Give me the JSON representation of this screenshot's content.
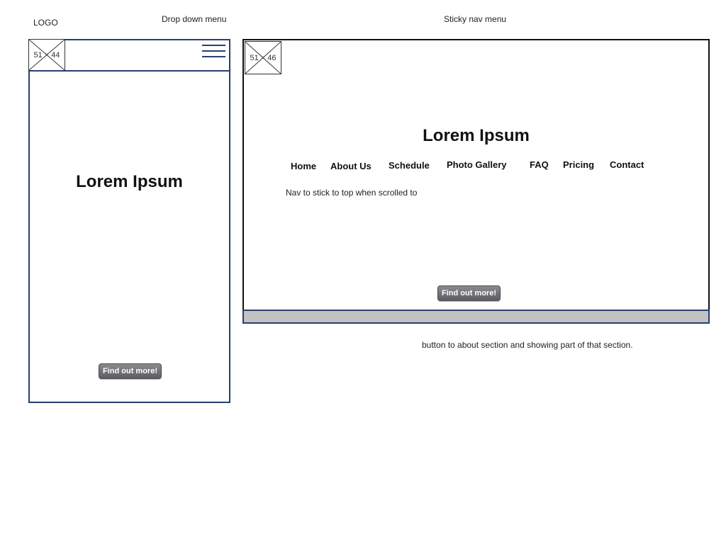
{
  "annotations": {
    "logo": "LOGO",
    "dropdown": "Drop down menu",
    "sticky": "Sticky nav menu",
    "button_note": "button to about section and showing part of that section."
  },
  "mobile": {
    "logo_placeholder": "51 × 44",
    "menu_icon": "hamburger-menu-icon",
    "title": "Lorem Ipsum",
    "button": "Find out more!"
  },
  "desktop": {
    "logo_placeholder": "51 × 46",
    "title": "Lorem Ipsum",
    "nav": [
      "Home",
      "About Us",
      "Schedule",
      "Photo Gallery",
      "FAQ",
      "Pricing",
      "Contact"
    ],
    "nav_note": "Nav to stick to top when scrolled to",
    "button": "Find out more!"
  },
  "colors": {
    "frame_border": "#27406f",
    "footer_fill": "#c2c2c2",
    "button_fill": "#5c5c62"
  }
}
